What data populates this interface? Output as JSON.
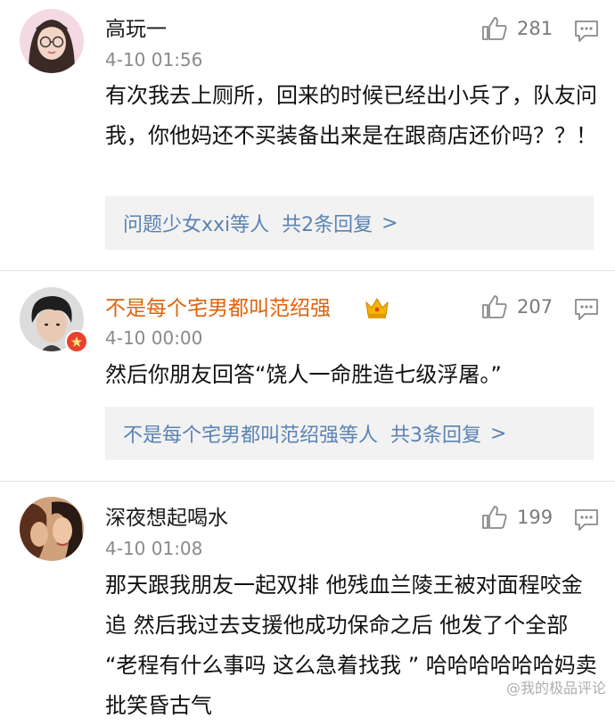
{
  "comments": [
    {
      "username": "高玩一",
      "time": "4-10 01:56",
      "likes": "281",
      "text": "有次我去上厕所，回来的时候已经出小兵了，队友问我，你他妈还不买装备出来是在跟商店还价吗？？！",
      "reply_names": "问题少女xxi等人",
      "reply_count": "共2条回复",
      "avatar": "girl-avatar"
    },
    {
      "username": "不是每个宅男都叫范绍强",
      "time": "4-10 00:00",
      "likes": "207",
      "text": "然后你朋友回答“饶人一命胜造七级浮屠。”",
      "reply_names": "不是每个宅男都叫范绍强等人",
      "reply_count": "共3条回复",
      "avatar": "boy-avatar",
      "name_color": "#e0620a",
      "badge": "crown-icon"
    },
    {
      "username": "深夜想起喝水",
      "time": "4-10 01:08",
      "likes": "199",
      "text": "那天跟我朋友一起双排  他残血兰陵王被对面程咬金追  然后我过去支援他成功保命之后 他发了个全部 “老程有什么事吗 这么急着找我 ” 哈哈哈哈哈哈妈卖批笑昏古气",
      "avatar": "couple-avatar"
    }
  ],
  "reply_chevron": ">",
  "watermark": "@我的极品评论",
  "colors": {
    "link": "#5a83b3",
    "vip_name": "#e0620a",
    "meta": "#8a8a8a"
  }
}
